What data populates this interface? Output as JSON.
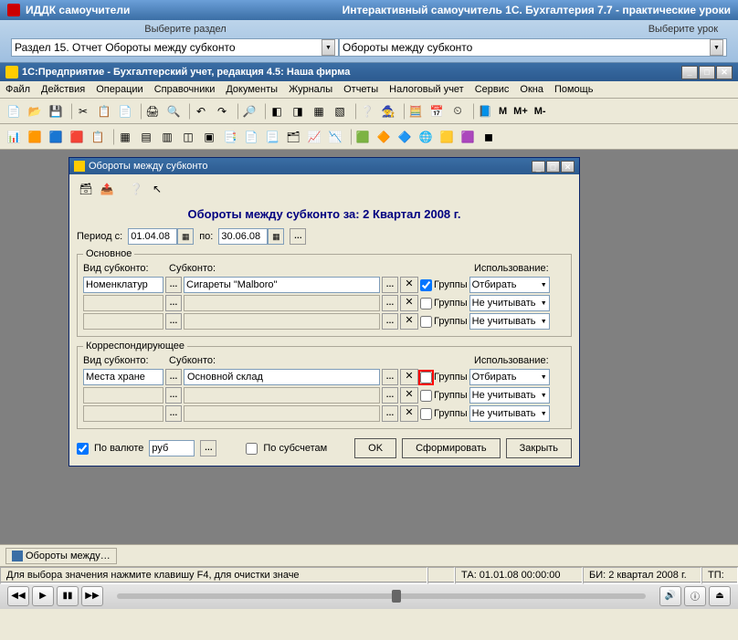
{
  "outer": {
    "product": "ИДДК самоучители",
    "subtitle": "Интерактивный самоучитель 1С. Бухгалтерия 7.7 - практические уроки",
    "select_section": "Выберите раздел",
    "select_lesson": "Выберите урок",
    "section": "Раздел 15. Отчет Обороты между субконто",
    "lesson": "Обороты между субконто"
  },
  "app": {
    "title": "1С:Предприятие - Бухгалтерский учет, редакция 4.5: Наша фирма",
    "menu": [
      "Файл",
      "Действия",
      "Операции",
      "Справочники",
      "Документы",
      "Журналы",
      "Отчеты",
      "Налоговый учет",
      "Сервис",
      "Окна",
      "Помощь"
    ],
    "m_plus": "M+",
    "m_minus": "M-",
    "m": "M"
  },
  "dlg": {
    "title": "Обороты между субконто",
    "heading": "Обороты между субконто за: 2 Квартал 2008 г.",
    "period_from_lbl": "Период с:",
    "period_from": "01.04.08",
    "period_to_lbl": "по:",
    "period_to": "30.06.08",
    "main_legend": "Основное",
    "corr_legend": "Корреспондирующее",
    "col_type": "Вид субконто:",
    "col_sub": "Субконто:",
    "col_usage": "Использование:",
    "groups_lbl": "Группы",
    "main_rows": [
      {
        "type": "Номенклатур",
        "sub": "Сигареты \"Malboro\"",
        "groups": true,
        "usage": "Отбирать"
      },
      {
        "type": "",
        "sub": "",
        "groups": false,
        "usage": "Не учитывать"
      },
      {
        "type": "",
        "sub": "",
        "groups": false,
        "usage": "Не учитывать"
      }
    ],
    "corr_rows": [
      {
        "type": "Места хране",
        "sub": "Основной склад",
        "groups": false,
        "usage": "Отбирать",
        "highlight": true
      },
      {
        "type": "",
        "sub": "",
        "groups": false,
        "usage": "Не учитывать"
      },
      {
        "type": "",
        "sub": "",
        "groups": false,
        "usage": "Не учитывать"
      }
    ],
    "by_currency": "По валюте",
    "currency": "руб",
    "by_subaccounts": "По субсчетам",
    "ok": "OK",
    "form": "Сформировать",
    "close": "Закрыть"
  },
  "tabs": {
    "tab1": "Обороты между…"
  },
  "status": {
    "hint": "Для выбора значения нажмите клавишу F4, для очистки значе",
    "ta": "ТА: 01.01.08  00:00:00",
    "bi": "БИ: 2 квартал 2008 г.",
    "tp": "ТП:"
  }
}
